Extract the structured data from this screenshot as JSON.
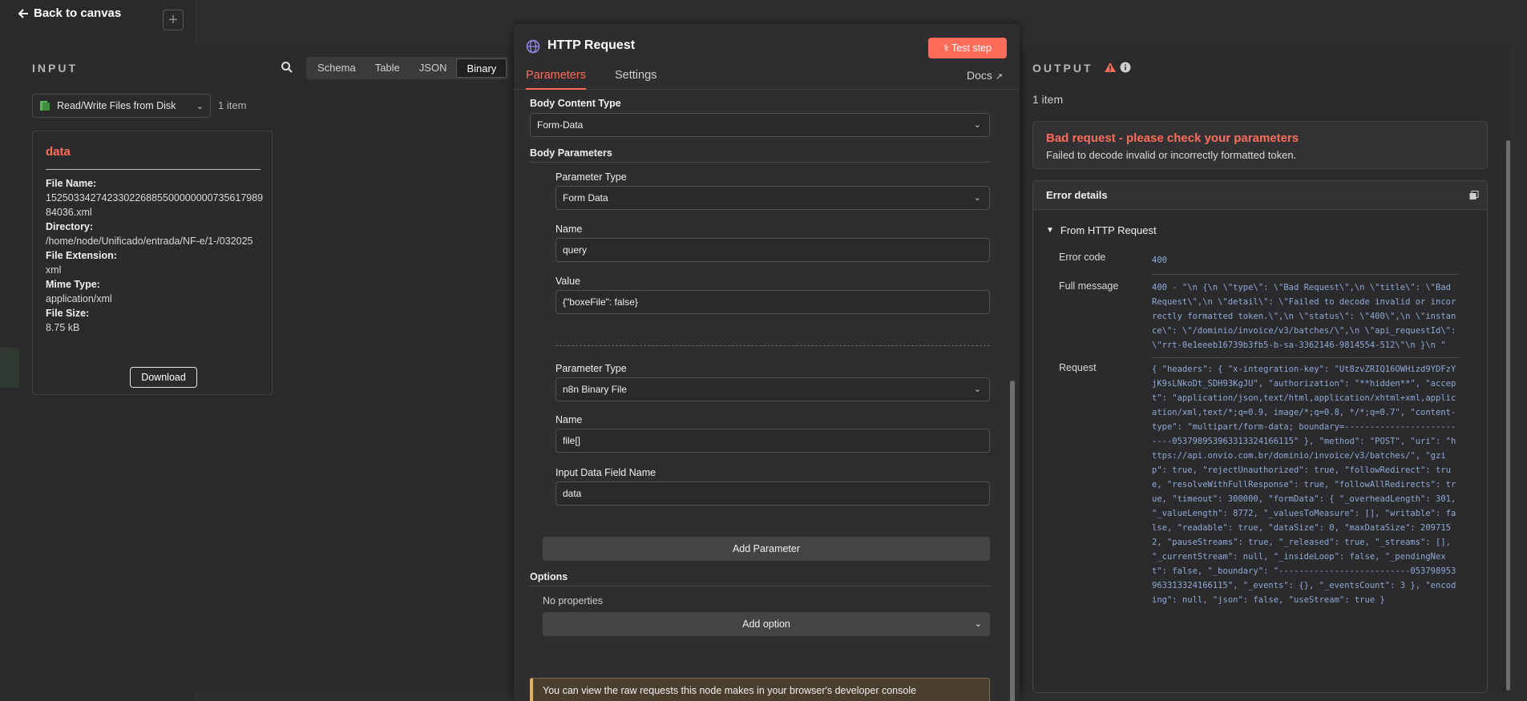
{
  "canvas": {
    "back_label": "Back to canvas",
    "plus_label": "+"
  },
  "input": {
    "title": "INPUT",
    "tabs": [
      "Schema",
      "Table",
      "JSON",
      "Binary"
    ],
    "active_tab": "Binary",
    "node_select": "Read/Write Files from Disk",
    "item_count": "1 item",
    "card": {
      "title": "data",
      "fields": [
        {
          "key": "File Name:",
          "value": "15250334274233022688550000000073561798984036.xml"
        },
        {
          "key": "Directory:",
          "value": "/home/node/Unificado/entrada/NF-e/1-/032025"
        },
        {
          "key": "File Extension:",
          "value": "xml"
        },
        {
          "key": "Mime Type:",
          "value": "application/xml"
        },
        {
          "key": "File Size:",
          "value": "8.75 kB"
        }
      ],
      "download_label": "Download"
    }
  },
  "node": {
    "name": "HTTP Request",
    "test_label": "Test step",
    "tabs": {
      "parameters": "Parameters",
      "settings": "Settings"
    },
    "docs_label": "Docs",
    "params": {
      "body_content_type_label": "Body Content Type",
      "body_content_type_value": "Form-Data",
      "body_parameters_label": "Body Parameters",
      "p1": {
        "type_label": "Parameter Type",
        "type_value": "Form Data",
        "name_label": "Name",
        "name_value": "query",
        "value_label": "Value",
        "value_value": "{\"boxeFile\": false}"
      },
      "p2": {
        "type_label": "Parameter Type",
        "type_value": "n8n Binary File",
        "name_label": "Name",
        "name_value": "file[]",
        "field_label": "Input Data Field Name",
        "field_value": "data"
      },
      "add_parameter_label": "Add Parameter",
      "options_label": "Options",
      "no_properties": "No properties",
      "add_option_label": "Add option",
      "notice": "You can view the raw requests this node makes in your browser's developer console"
    }
  },
  "output": {
    "title": "OUTPUT",
    "item_count": "1 item",
    "error_title": "Bad request - please check your parameters",
    "error_desc": "Failed to decode invalid or incorrectly formatted token.",
    "details_title": "Error details",
    "from_label": "From HTTP Request",
    "rows": [
      {
        "key": "Error code",
        "value": "400"
      },
      {
        "key": "Full message",
        "value": "400 - \"\\n {\\n \\\"type\\\": \\\"Bad Request\\\",\\n \\\"title\\\": \\\"Bad Request\\\",\\n \\\"detail\\\": \\\"Failed to decode invalid or incorrectly formatted token.\\\",\\n \\\"status\\\": \\\"400\\\",\\n \\\"instance\\\": \\\"/dominio/invoice/v3/batches/\\\",\\n \\\"api_requestId\\\": \\\"rrt-0e1eeeb16739b3fb5-b-sa-3362146-9814554-512\\\"\\n }\\n \""
      },
      {
        "key": "Request",
        "value": "{ \"headers\": { \"x-integration-key\": \"Ut8zvZRIQ16OWHizd9YDFzYjK9sLNkoDt_SDH93KgJU\", \"authorization\": \"**hidden**\", \"accept\": \"application/json,text/html,application/xhtml+xml,application/xml,text/*;q=0.9, image/*;q=0.8, */*;q=0.7\", \"content-type\": \"multipart/form-data; boundary=--------------------------053798953963313324166115\" }, \"method\": \"POST\", \"uri\": \"https://api.onvio.com.br/dominio/invoice/v3/batches/\", \"gzip\": true, \"rejectUnauthorized\": true, \"followRedirect\": true, \"resolveWithFullResponse\": true, \"followAllRedirects\": true, \"timeout\": 300000, \"formData\": { \"_overheadLength\": 301, \"_valueLength\": 8772, \"_valuesToMeasure\": [], \"writable\": false, \"readable\": true, \"dataSize\": 0, \"maxDataSize\": 2097152, \"pauseStreams\": true, \"_released\": true, \"_streams\": [], \"_currentStream\": null, \"_insideLoop\": false, \"_pendingNext\": false, \"_boundary\": \"--------------------------053798953963313324166115\", \"_events\": {}, \"_eventsCount\": 3 }, \"encoding\": null, \"json\": false, \"useStream\": true }"
      }
    ]
  },
  "colors": {
    "accent": "#ff6d5a",
    "mono_value": "#8fa9d6"
  }
}
